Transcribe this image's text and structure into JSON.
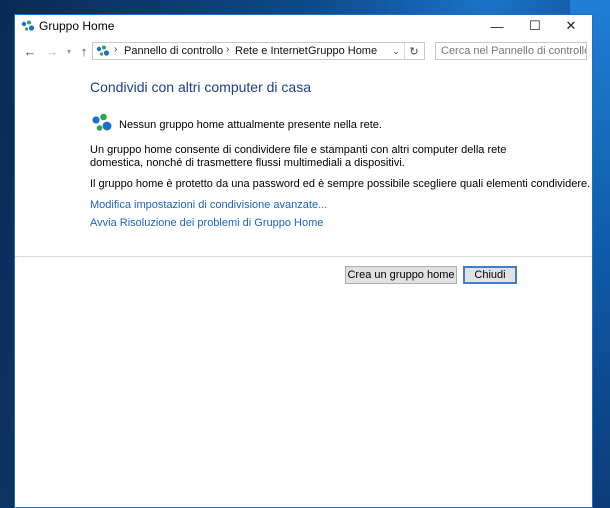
{
  "window": {
    "title": "Gruppo Home",
    "controls": {
      "minimize": "—",
      "maximize": "☐",
      "close": "✕"
    }
  },
  "navigation": {
    "back": "←",
    "forward": "→",
    "recent": "▾",
    "up": "↑"
  },
  "address_bar": {
    "separator": "›",
    "crumbs": [
      "Pannello di controllo",
      "Rete e Internet",
      "Gruppo Home"
    ],
    "dropdown": "⌄",
    "refresh": "↻"
  },
  "search": {
    "placeholder": "Cerca nel Pannello di controllo"
  },
  "content": {
    "heading": "Condividi con altri computer di casa",
    "status": "Nessun gruppo home attualmente presente nella rete.",
    "description": "Un gruppo home consente di condividere file e stampanti con altri computer della rete domestica, nonché di trasmettere flussi multimediali a dispositivi.",
    "password_note": "Il gruppo home è protetto da una password ed è sempre possibile scegliere quali elementi condividere.",
    "link_advanced": "Modifica impostazioni di condivisione avanzate...",
    "link_troubleshoot": "Avvia Risoluzione dei problemi di Gruppo Home"
  },
  "buttons": {
    "create": "Crea un gruppo home",
    "close": "Chiudi"
  },
  "colors": {
    "heading": "#1e3f8f",
    "link": "#1d63c5",
    "window_border": "#1e6fc2",
    "icon_green": "#2aa84a",
    "icon_blue": "#1d6fc9"
  }
}
